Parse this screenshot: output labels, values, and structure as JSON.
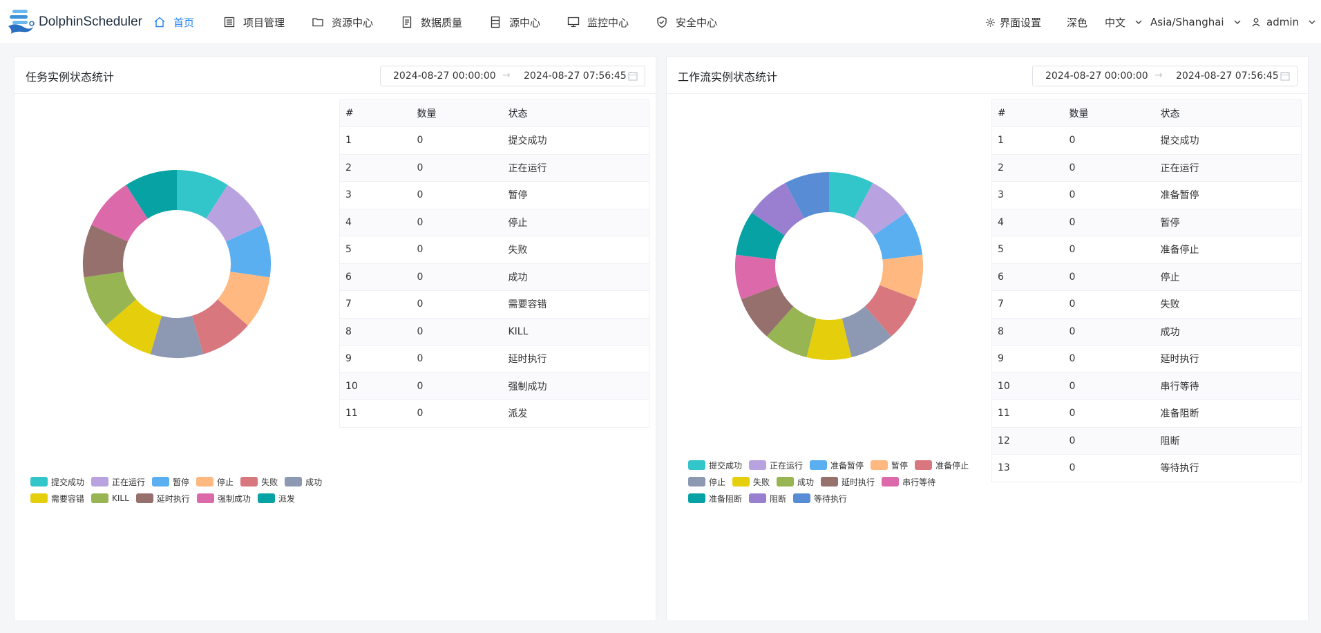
{
  "brand": {
    "name": "DolphinScheduler"
  },
  "nav": [
    {
      "label": "首页",
      "icon": "home-icon",
      "active": true
    },
    {
      "label": "项目管理",
      "icon": "project-icon"
    },
    {
      "label": "资源中心",
      "icon": "folder-icon"
    },
    {
      "label": "数据质量",
      "icon": "data-quality-icon"
    },
    {
      "label": "源中心",
      "icon": "datasource-icon"
    },
    {
      "label": "监控中心",
      "icon": "monitor-icon"
    },
    {
      "label": "安全中心",
      "icon": "shield-icon"
    }
  ],
  "header_right": {
    "settings": "界面设置",
    "theme": "深色",
    "language": "中文",
    "timezone": "Asia/Shanghai",
    "user": "admin"
  },
  "colors": {
    "accent": "#2080f0",
    "palette": [
      "#32c5c9",
      "#b8a2e0",
      "#5aaff0",
      "#ffb980",
      "#d9777f",
      "#8d98b3",
      "#e5cf0d",
      "#97b552",
      "#95706d",
      "#dc69aa",
      "#07a2a4",
      "#9a7fd1",
      "#588dd5"
    ]
  },
  "task_panel": {
    "title": "任务实例状态统计",
    "range_start": "2024-08-27 00:00:00",
    "range_end": "2024-08-27 07:56:45",
    "table_headers": [
      "#",
      "数量",
      "状态"
    ],
    "rows": [
      {
        "idx": "1",
        "count": "0",
        "state": "提交成功"
      },
      {
        "idx": "2",
        "count": "0",
        "state": "正在运行"
      },
      {
        "idx": "3",
        "count": "0",
        "state": "暂停"
      },
      {
        "idx": "4",
        "count": "0",
        "state": "停止"
      },
      {
        "idx": "5",
        "count": "0",
        "state": "失败"
      },
      {
        "idx": "6",
        "count": "0",
        "state": "成功"
      },
      {
        "idx": "7",
        "count": "0",
        "state": "需要容错"
      },
      {
        "idx": "8",
        "count": "0",
        "state": "KILL"
      },
      {
        "idx": "9",
        "count": "0",
        "state": "延时执行"
      },
      {
        "idx": "10",
        "count": "0",
        "state": "强制成功"
      },
      {
        "idx": "11",
        "count": "0",
        "state": "派发"
      }
    ]
  },
  "workflow_panel": {
    "title": "工作流实例状态统计",
    "range_start": "2024-08-27 00:00:00",
    "range_end": "2024-08-27 07:56:45",
    "table_headers": [
      "#",
      "数量",
      "状态"
    ],
    "rows": [
      {
        "idx": "1",
        "count": "0",
        "state": "提交成功"
      },
      {
        "idx": "2",
        "count": "0",
        "state": "正在运行"
      },
      {
        "idx": "3",
        "count": "0",
        "state": "准备暂停"
      },
      {
        "idx": "4",
        "count": "0",
        "state": "暂停"
      },
      {
        "idx": "5",
        "count": "0",
        "state": "准备停止"
      },
      {
        "idx": "6",
        "count": "0",
        "state": "停止"
      },
      {
        "idx": "7",
        "count": "0",
        "state": "失败"
      },
      {
        "idx": "8",
        "count": "0",
        "state": "成功"
      },
      {
        "idx": "9",
        "count": "0",
        "state": "延时执行"
      },
      {
        "idx": "10",
        "count": "0",
        "state": "串行等待"
      },
      {
        "idx": "11",
        "count": "0",
        "state": "准备阻断"
      },
      {
        "idx": "12",
        "count": "0",
        "state": "阻断"
      },
      {
        "idx": "13",
        "count": "0",
        "state": "等待执行"
      }
    ]
  },
  "chart_data": [
    {
      "type": "pie",
      "donut": true,
      "title": "",
      "categories": [
        "提交成功",
        "正在运行",
        "暂停",
        "停止",
        "失败",
        "成功",
        "需要容错",
        "KILL",
        "延时执行",
        "强制成功",
        "派发"
      ],
      "values": [
        0,
        0,
        0,
        0,
        0,
        0,
        0,
        0,
        0,
        0,
        0
      ],
      "colors": [
        "#32c5c9",
        "#b8a2e0",
        "#5aaff0",
        "#ffb980",
        "#d9777f",
        "#8d98b3",
        "#e5cf0d",
        "#97b552",
        "#95706d",
        "#dc69aa",
        "#07a2a4"
      ],
      "legend": "bottom-left"
    },
    {
      "type": "pie",
      "donut": true,
      "title": "",
      "categories": [
        "提交成功",
        "正在运行",
        "准备暂停",
        "暂停",
        "准备停止",
        "停止",
        "失败",
        "成功",
        "延时执行",
        "串行等待",
        "准备阻断",
        "阻断",
        "等待执行"
      ],
      "values": [
        0,
        0,
        0,
        0,
        0,
        0,
        0,
        0,
        0,
        0,
        0,
        0,
        0
      ],
      "colors": [
        "#32c5c9",
        "#b8a2e0",
        "#5aaff0",
        "#ffb980",
        "#d9777f",
        "#8d98b3",
        "#e5cf0d",
        "#97b552",
        "#95706d",
        "#dc69aa",
        "#07a2a4",
        "#9a7fd1",
        "#588dd5"
      ],
      "legend": "bottom-left"
    }
  ]
}
